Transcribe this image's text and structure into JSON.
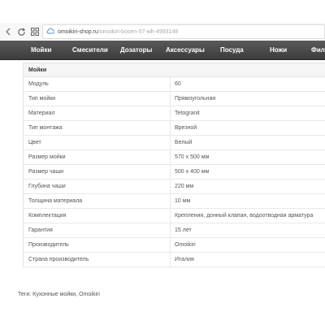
{
  "browser": {
    "url_host": "omoikiri-shop.ru",
    "url_path": "/omoikiri-bosen-57-wh-4993148"
  },
  "nav": {
    "items": [
      "Мойки",
      "Смесители",
      "Дозаторы",
      "Аксессуары",
      "Посуда",
      "Ножи",
      "Фил"
    ]
  },
  "specs": {
    "section_title": "Мойки",
    "rows": [
      {
        "key": "Модуль",
        "value": "60"
      },
      {
        "key": "Тип мойки",
        "value": "Прямоугольная"
      },
      {
        "key": "Материал",
        "value": "Tetogranit"
      },
      {
        "key": "Тип монтажа",
        "value": "Врезной"
      },
      {
        "key": "Цвет",
        "value": "Белый"
      },
      {
        "key": "Размер мойки",
        "value": "570 x 500 мм"
      },
      {
        "key": "Размер чаши",
        "value": "500 x 400 мм"
      },
      {
        "key": "Глубина чаши",
        "value": "220 мм"
      },
      {
        "key": "Толщина материала",
        "value": "10 мм"
      },
      {
        "key": "Комплектация",
        "value": "Крепления, донный клапан, водоотводная арматура"
      },
      {
        "key": "Гарантия",
        "value": "15 лет"
      },
      {
        "key": "Производитель",
        "value": "Omoikiri"
      },
      {
        "key": "Страна производитель",
        "value": "Италия"
      }
    ]
  },
  "tags": {
    "label": "Теги:",
    "links": [
      "Кухонные мойки",
      "Omoikiri"
    ],
    "separator": ","
  },
  "icons": {
    "back": "chevron-left-icon",
    "reload": "reload-icon",
    "apps": "grid-icon",
    "site": "cloud-icon"
  }
}
